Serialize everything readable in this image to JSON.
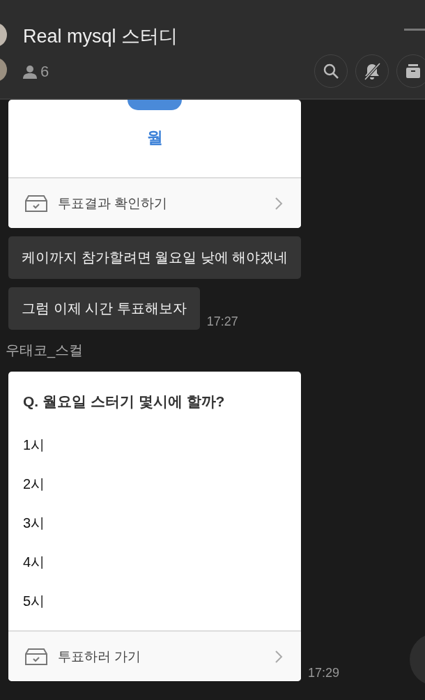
{
  "header": {
    "title": "Real mysql 스터디",
    "member_count": "6"
  },
  "messages": [
    {
      "kind": "poll_result",
      "result": "월",
      "action": "투표결과 확인하기"
    },
    {
      "kind": "text",
      "text": "케이까지 참가할려면 월요일 낮에 해야겠네"
    },
    {
      "kind": "text",
      "text": "그럼 이제 시간 투표해보자",
      "time": "17:27"
    },
    {
      "kind": "sender",
      "name": "우태코_스컬"
    },
    {
      "kind": "poll",
      "question": "Q. 월요일 스터기 몇시에 할까?",
      "options": [
        "1시",
        "2시",
        "3시",
        "4시",
        "5시"
      ],
      "action": "투표하러 가기",
      "time": "17:29"
    }
  ]
}
